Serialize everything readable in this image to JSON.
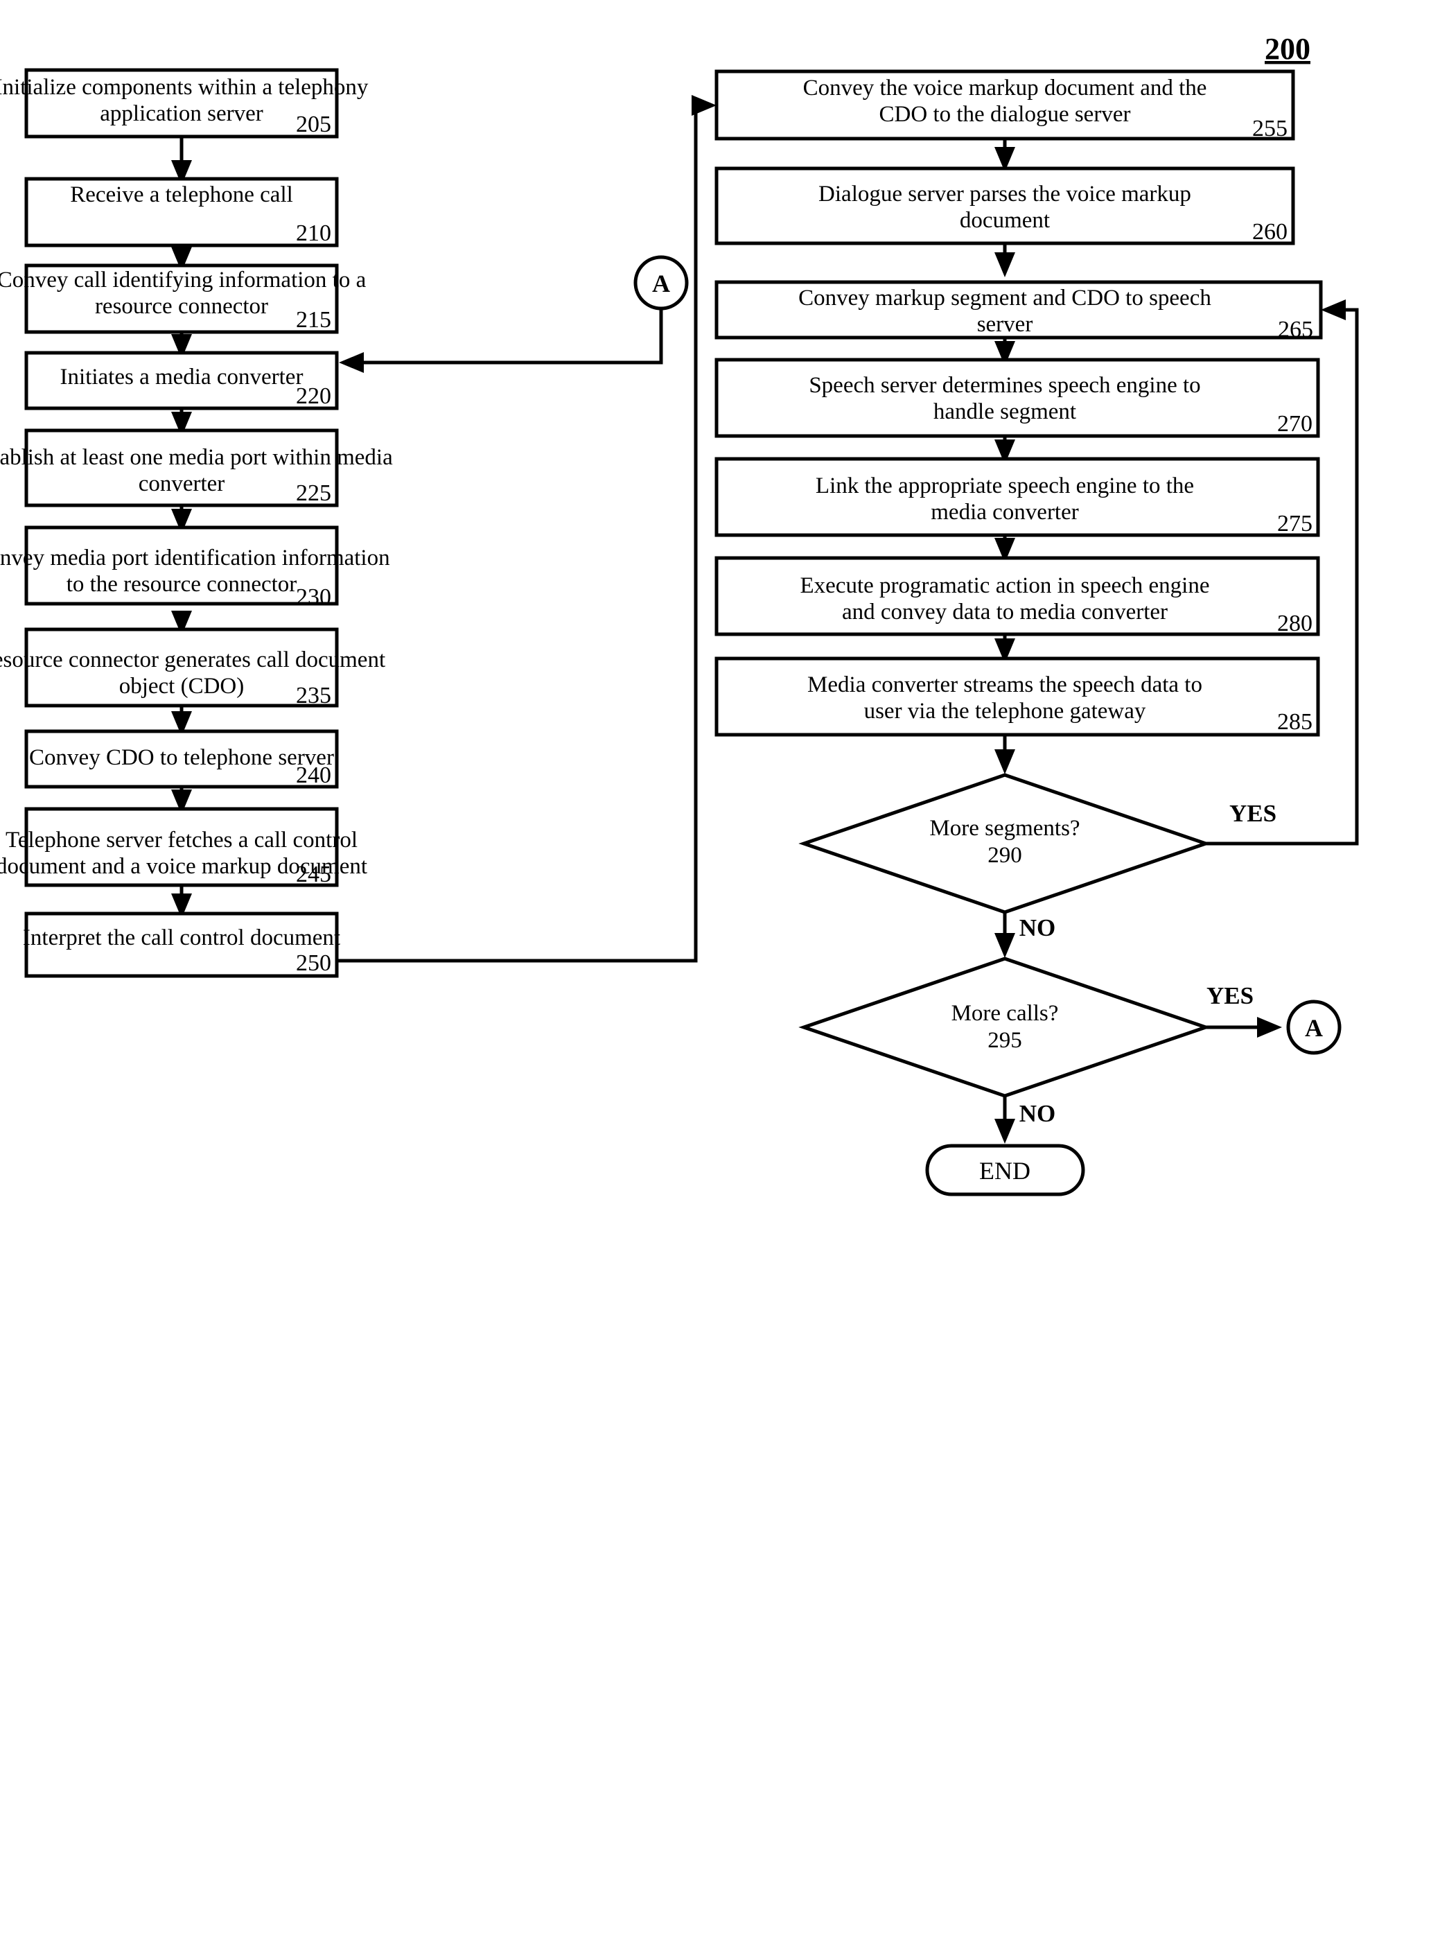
{
  "figure": {
    "number": "200"
  },
  "connectors": {
    "a_label": "A"
  },
  "terminator": {
    "end_label": "END"
  },
  "edge_labels": {
    "yes": "YES",
    "no": "NO"
  },
  "left_column": [
    {
      "id": "b205",
      "text_lines": [
        "Initialize components within a telephony",
        "application server"
      ],
      "number": "205"
    },
    {
      "id": "b210",
      "text_lines": [
        "Receive a telephone call"
      ],
      "number": "210"
    },
    {
      "id": "b215",
      "text_lines": [
        "Convey call identifying information to a",
        "resource connector"
      ],
      "number": "215"
    },
    {
      "id": "b220",
      "text_lines": [
        "Initiates a media converter"
      ],
      "number": "220"
    },
    {
      "id": "b225",
      "text_lines": [
        "Establish at least one media port within media",
        "converter"
      ],
      "number": "225"
    },
    {
      "id": "b230",
      "text_lines": [
        "Convey media port identification information",
        "to the resource connector"
      ],
      "number": "230"
    },
    {
      "id": "b235",
      "text_lines": [
        "Resource connector generates call document",
        "object (CDO)"
      ],
      "number": "235"
    },
    {
      "id": "b240",
      "text_lines": [
        "Convey CDO to telephone server"
      ],
      "number": "240"
    },
    {
      "id": "b245",
      "text_lines": [
        "Telephone server fetches a call control",
        "document and a voice markup document"
      ],
      "number": "245"
    },
    {
      "id": "b250",
      "text_lines": [
        "Interpret the call control document"
      ],
      "number": "250"
    }
  ],
  "right_column": [
    {
      "id": "b255",
      "text_lines": [
        "Convey the voice markup document and the",
        "CDO to the dialogue server"
      ],
      "number": "255"
    },
    {
      "id": "b260",
      "text_lines": [
        "Dialogue server parses the voice markup",
        "document"
      ],
      "number": "260"
    },
    {
      "id": "b265",
      "text_lines": [
        "Convey markup segment and CDO to speech",
        "server"
      ],
      "number": "265"
    },
    {
      "id": "b270",
      "text_lines": [
        "Speech server determines speech engine to",
        "handle segment"
      ],
      "number": "270"
    },
    {
      "id": "b275",
      "text_lines": [
        "Link the appropriate speech engine to the",
        "media converter"
      ],
      "number": "275"
    },
    {
      "id": "b280",
      "text_lines": [
        "Execute programatic action in speech engine",
        "and convey data to media converter"
      ],
      "number": "280"
    },
    {
      "id": "b285",
      "text_lines": [
        "Media converter streams the speech data to",
        "user via the telephone gateway"
      ],
      "number": "285"
    }
  ],
  "decisions": [
    {
      "id": "d290",
      "text": "More segments?",
      "number": "290",
      "yes_label": "YES",
      "no_label": "NO"
    },
    {
      "id": "d295",
      "text": "More calls?",
      "number": "295",
      "yes_label": "YES",
      "no_label": "NO"
    }
  ]
}
